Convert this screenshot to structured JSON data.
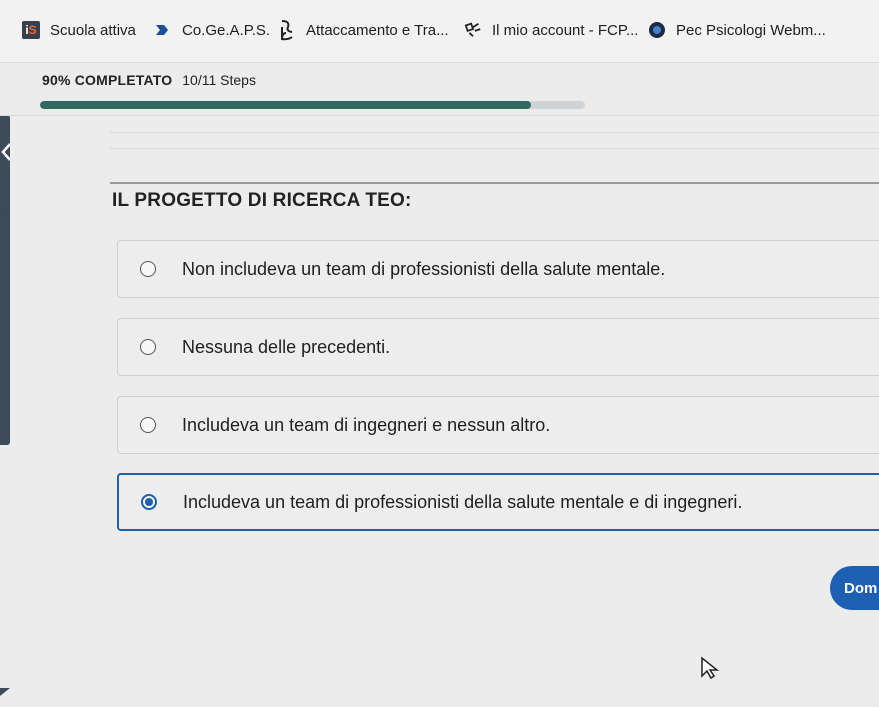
{
  "bookmarks": [
    {
      "label": "Scuola attiva",
      "icon": "scuola-attiva-logo-icon"
    },
    {
      "label": "Co.Ge.A.P.S.",
      "icon": "cogeaps-logo-icon"
    },
    {
      "label": "Attaccamento e Tra...",
      "icon": "attaccamento-logo-icon"
    },
    {
      "label": "Il mio account - FCP...",
      "icon": "fcp-logo-icon"
    },
    {
      "label": "Pec Psicologi Webm...",
      "icon": "pec-logo-icon"
    }
  ],
  "progress": {
    "percent_label": "90% COMPLETATO",
    "steps_label": "10/11 Steps",
    "fraction": 0.9,
    "fill_color": "#2f6b5d",
    "track_color": "#cfd3d6"
  },
  "quiz": {
    "question": "IL PROGETTO DI RICERCA TEO:",
    "options": [
      {
        "label": "Non includeva un team di professionisti della salute mentale.",
        "selected": false
      },
      {
        "label": "Nessuna delle precedenti.",
        "selected": false
      },
      {
        "label": "Includeva un team di ingegneri e nessun altro.",
        "selected": false
      },
      {
        "label": "Includeva un team di professionisti della salute mentale e di ingegneri.",
        "selected": true
      }
    ],
    "accent_color": "#1d5fb0"
  },
  "actions": {
    "submit_label": "Dom"
  }
}
